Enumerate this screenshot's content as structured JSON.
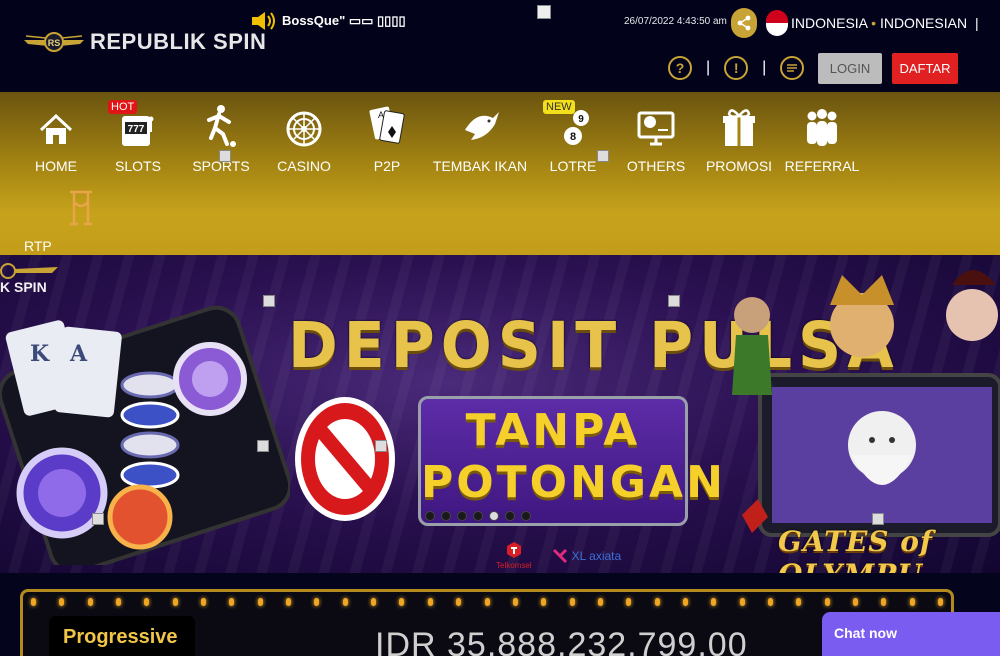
{
  "header": {
    "brand": "REPUBLIK SPIN",
    "marquee": "BossQue\" ▭▭ ▯▯▯▯",
    "datetime": "26/07/2022 4:43:50 am",
    "lang_a": "INDONESIA",
    "lang_b": "INDONESIAN",
    "login_label": "LOGIN",
    "register_label": "DAFTAR",
    "icons": [
      "help-icon",
      "info-icon",
      "chat-bubble-icon",
      "share-icon",
      "speaker-icon"
    ]
  },
  "nav": {
    "items": [
      {
        "label": "HOME",
        "icon": "house-icon"
      },
      {
        "label": "SLOTS",
        "icon": "slot-machine-icon",
        "badge": "HOT"
      },
      {
        "label": "SPORTS",
        "icon": "soccer-player-icon"
      },
      {
        "label": "CASINO",
        "icon": "roulette-icon"
      },
      {
        "label": "P2P",
        "icon": "cards-icon"
      },
      {
        "label": "TEMBAK IKAN",
        "icon": "fish-icon"
      },
      {
        "label": "LOTRE",
        "icon": "lottery-balls-icon",
        "badge": "NEW"
      },
      {
        "label": "OTHERS",
        "icon": "monitor-ball-icon"
      },
      {
        "label": "PROMOSI",
        "icon": "gift-icon"
      },
      {
        "label": "REFERRAL",
        "icon": "people-icon"
      },
      {
        "label": "RTP REPUBLIKSPIN",
        "icon": "rtp-logo-icon"
      }
    ]
  },
  "banner": {
    "logo_text": "K SPIN",
    "headline": "DEPOSIT PULSA",
    "line1": "TANPA",
    "line2": "POTONGAN",
    "partner1": "Telkomsel",
    "partner2": "XL axiata",
    "game_title": "GATES of OLYMPU",
    "slide_count": 7,
    "active_slide": 5
  },
  "progressive": {
    "label": "Progressive",
    "value": "IDR 35,888,232,799.00"
  },
  "chat": {
    "label": "Chat now"
  },
  "colors": {
    "gold": "#c8a335",
    "header_bg": "#02031b",
    "register_red": "#e12121",
    "chat_purple": "#7a5cf0"
  }
}
